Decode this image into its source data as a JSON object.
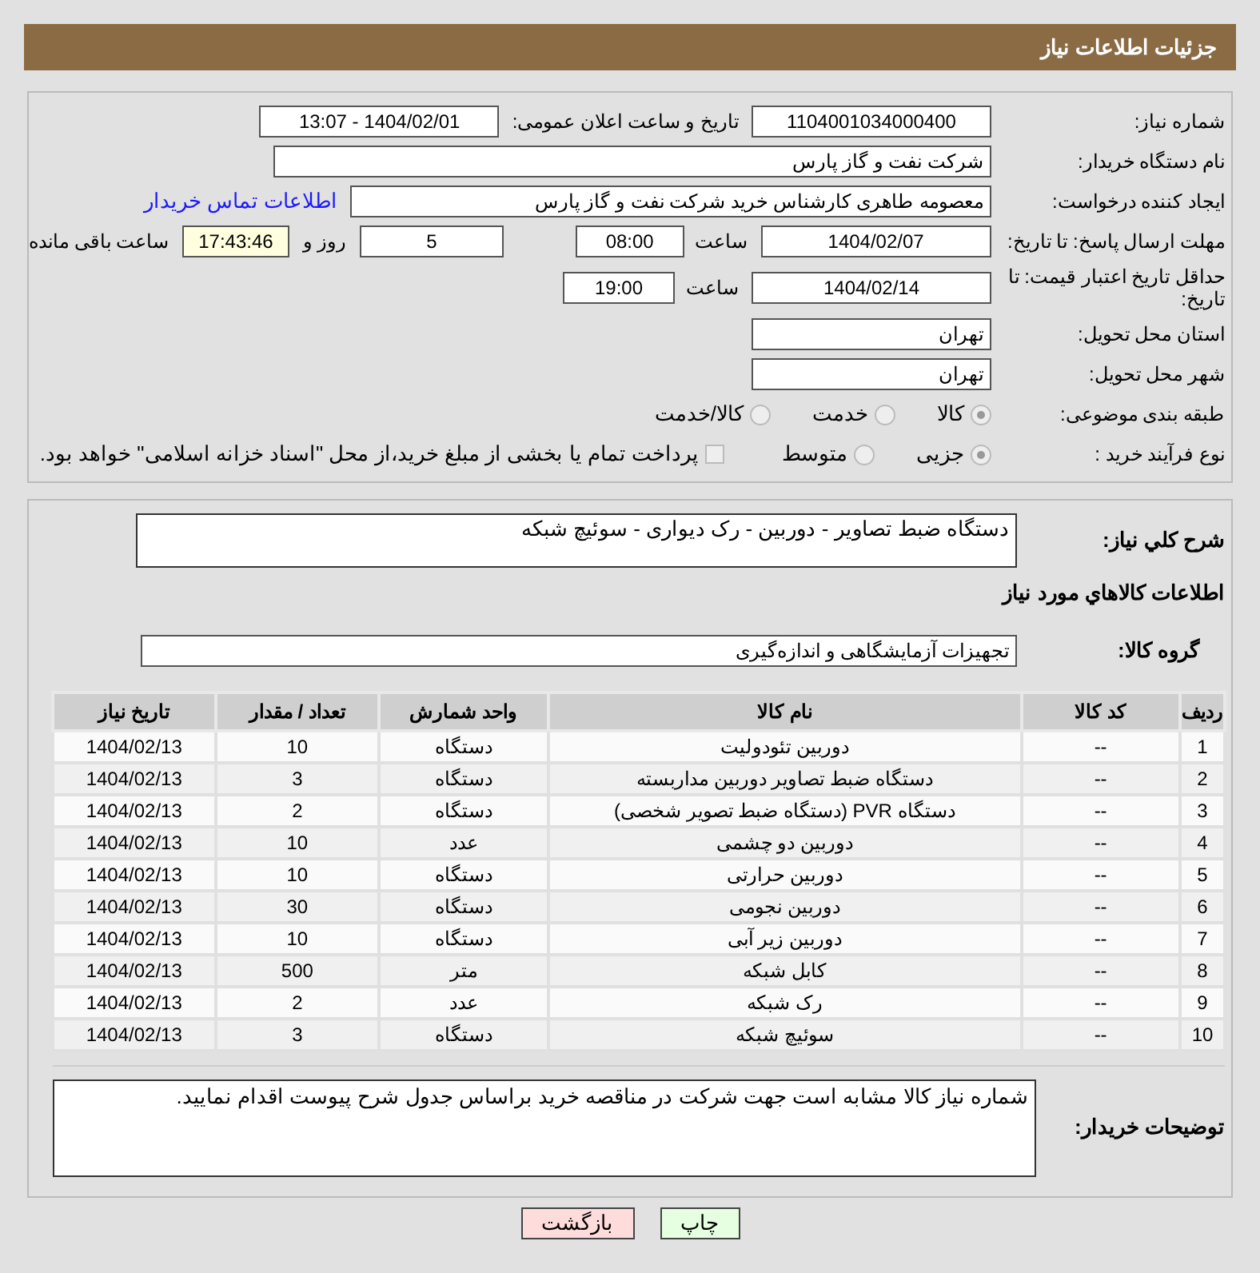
{
  "header": {
    "title": "جزئیات اطلاعات نیاز"
  },
  "need_number": {
    "label": "شماره نیاز:",
    "value": "1104001034000400"
  },
  "announce": {
    "label": "تاریخ و ساعت اعلان عمومی:",
    "value": "1404/02/01 - 13:07"
  },
  "buyer_org": {
    "label": "نام دستگاه خریدار:",
    "value": "شرکت نفت و گاز پارس"
  },
  "requester": {
    "label": "ایجاد کننده درخواست:",
    "value": "معصومه  طاهری کارشناس خرید  شرکت نفت و گاز پارس",
    "link": "اطلاعات تماس خریدار"
  },
  "deadline": {
    "label": "مهلت ارسال پاسخ: تا تاریخ:",
    "date": "1404/02/07",
    "time_label": "ساعت",
    "time": "08:00",
    "days": "5",
    "days_label": "روز و",
    "remaining": "17:43:46",
    "remaining_label": "ساعت باقی مانده"
  },
  "validity": {
    "label": "حداقل تاریخ اعتبار قیمت: تا تاریخ:",
    "date": "1404/02/14",
    "time_label": "ساعت",
    "time": "19:00"
  },
  "province": {
    "label": "استان محل تحویل:",
    "value": "تهران"
  },
  "city": {
    "label": "شهر محل تحویل:",
    "value": "تهران"
  },
  "category": {
    "label": "طبقه بندی موضوعی:",
    "options": [
      {
        "label": "کالا",
        "selected": true
      },
      {
        "label": "خدمت",
        "selected": false
      },
      {
        "label": "کالا/خدمت",
        "selected": false
      }
    ]
  },
  "process": {
    "label": "نوع فرآیند خرید :",
    "options": [
      {
        "label": "جزیی",
        "selected": true
      },
      {
        "label": "متوسط",
        "selected": false
      }
    ],
    "treasury": {
      "label": "پرداخت تمام یا بخشی از مبلغ خرید،از محل \"اسناد خزانه اسلامی\" خواهد بود.",
      "checked": false
    }
  },
  "description": {
    "label": "شرح کلي نياز:",
    "value": "دستگاه ضبط تصاویر - دوربین - رک دیواری - سوئیچ شبکه"
  },
  "goods_title": "اطلاعات کالاهاي مورد نياز",
  "goods_group": {
    "label": "گروه کالا:",
    "value": "تجهیزات آزمایشگاهی و اندازه‌گیری"
  },
  "table": {
    "columns": [
      "ردیف",
      "کد کالا",
      "نام کالا",
      "واحد شمارش",
      "تعداد / مقدار",
      "تاریخ نیاز"
    ],
    "rows": [
      [
        "1",
        "--",
        "دوربین تئودولیت",
        "دستگاه",
        "10",
        "1404/02/13"
      ],
      [
        "2",
        "--",
        "دستگاه ضبط تصاویر دوربین مداربسته",
        "دستگاه",
        "3",
        "1404/02/13"
      ],
      [
        "3",
        "--",
        "دستگاه PVR (دستگاه ضبط تصویر شخصی)",
        "دستگاه",
        "2",
        "1404/02/13"
      ],
      [
        "4",
        "--",
        "دوربین دو چشمی",
        "عدد",
        "10",
        "1404/02/13"
      ],
      [
        "5",
        "--",
        "دوربین حرارتی",
        "دستگاه",
        "10",
        "1404/02/13"
      ],
      [
        "6",
        "--",
        "دوربین نجومی",
        "دستگاه",
        "30",
        "1404/02/13"
      ],
      [
        "7",
        "--",
        "دوربین زیر آبی",
        "دستگاه",
        "10",
        "1404/02/13"
      ],
      [
        "8",
        "--",
        "کابل شبکه",
        "متر",
        "500",
        "1404/02/13"
      ],
      [
        "9",
        "--",
        "رک شبکه",
        "عدد",
        "2",
        "1404/02/13"
      ],
      [
        "10",
        "--",
        "سوئیچ شبکه",
        "دستگاه",
        "3",
        "1404/02/13"
      ]
    ]
  },
  "buyer_notes": {
    "label": "توضیحات خریدار:",
    "value": "شماره نیاز کالا مشابه است جهت شرکت در مناقصه خرید براساس جدول شرح پیوست اقدام نمایید."
  },
  "buttons": [
    {
      "label": "چاپ",
      "kind": "print"
    },
    {
      "label": "بازگشت",
      "kind": "back"
    }
  ]
}
